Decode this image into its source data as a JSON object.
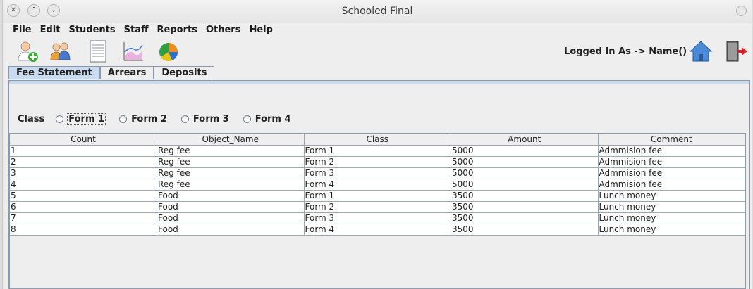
{
  "window": {
    "title": "Schooled Final"
  },
  "menu": [
    "File",
    "Edit",
    "Students",
    "Staff",
    "Reports",
    "Others",
    "Help"
  ],
  "toolbar": {
    "icons": [
      "add-user-icon",
      "users-group-icon",
      "document-icon",
      "chart-icon",
      "pie-chart-icon"
    ],
    "logged_in_text": "Logged In As -> Name()",
    "home_icon": "home-icon",
    "logout_icon": "logout-icon"
  },
  "tabs": [
    {
      "label": "Fee Statement",
      "active": true
    },
    {
      "label": "Arrears",
      "active": false
    },
    {
      "label": "Deposits",
      "active": false
    }
  ],
  "class_filter": {
    "label": "Class",
    "options": [
      "Form 1",
      "Form 2",
      "Form 3",
      "Form 4"
    ],
    "focused": "Form 1"
  },
  "table": {
    "columns": [
      "Count",
      "Object_Name",
      "Class",
      "Amount",
      "Comment"
    ],
    "rows": [
      [
        "1",
        "Reg fee",
        "Form 1",
        "5000",
        "Admmision fee"
      ],
      [
        "2",
        "Reg fee",
        "Form 2",
        "5000",
        "Admmision fee"
      ],
      [
        "3",
        "Reg fee",
        "Form 3",
        "5000",
        "Admmision fee"
      ],
      [
        "4",
        "Reg fee",
        "Form 4",
        "5000",
        "Admmision fee"
      ],
      [
        "5",
        "Food",
        "Form 1",
        "3500",
        "Lunch money"
      ],
      [
        "6",
        "Food",
        "Form 2",
        "3500",
        "Lunch money"
      ],
      [
        "7",
        "Food",
        "Form 3",
        "3500",
        "Lunch money"
      ],
      [
        "8",
        "Food",
        "Form 4",
        "3500",
        "Lunch money"
      ]
    ]
  },
  "colors": {
    "active_tab": "#c9dbee",
    "border": "#8a98ad"
  }
}
